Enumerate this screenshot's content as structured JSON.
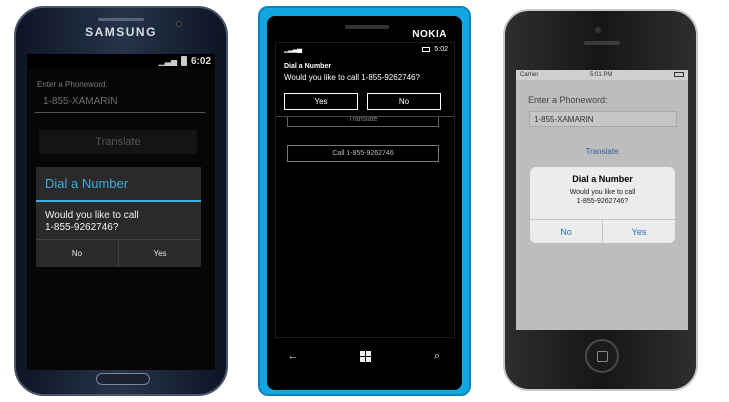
{
  "samsung": {
    "brand": "SAMSUNG",
    "status": {
      "time": "6:02"
    },
    "label": "Enter a Phoneword:",
    "input_value": "1-855-XAMARIN",
    "translate_label": "Translate",
    "dialog": {
      "title": "Dial a Number",
      "message_line1": "Would you like to call",
      "message_line2": "1-855-9262746?",
      "no_label": "No",
      "yes_label": "Yes"
    }
  },
  "nokia": {
    "brand": "NOKIA",
    "status": {
      "time": "5:02"
    },
    "dialog": {
      "title": "Dial a Number",
      "message": "Would you like to call 1-855-9262746?",
      "yes_label": "Yes",
      "no_label": "No"
    },
    "translate_label": "Translate",
    "call_label": "Call 1-855-9262746",
    "nav": {
      "back": "←",
      "search": "⌕"
    }
  },
  "iphone": {
    "status": {
      "carrier": "Carrier",
      "time": "5:01 PM"
    },
    "label": "Enter a Phoneword:",
    "input_value": "1-855-XAMARIN",
    "translate_label": "Translate",
    "alert": {
      "title": "Dial a Number",
      "message_line1": "Would you like to call",
      "message_line2": "1-855-9262746?",
      "no_label": "No",
      "yes_label": "Yes"
    }
  },
  "colors": {
    "android_accent": "#3aaee0",
    "nokia_body": "#12a6e2",
    "ios_button": "#2f6fc9"
  }
}
